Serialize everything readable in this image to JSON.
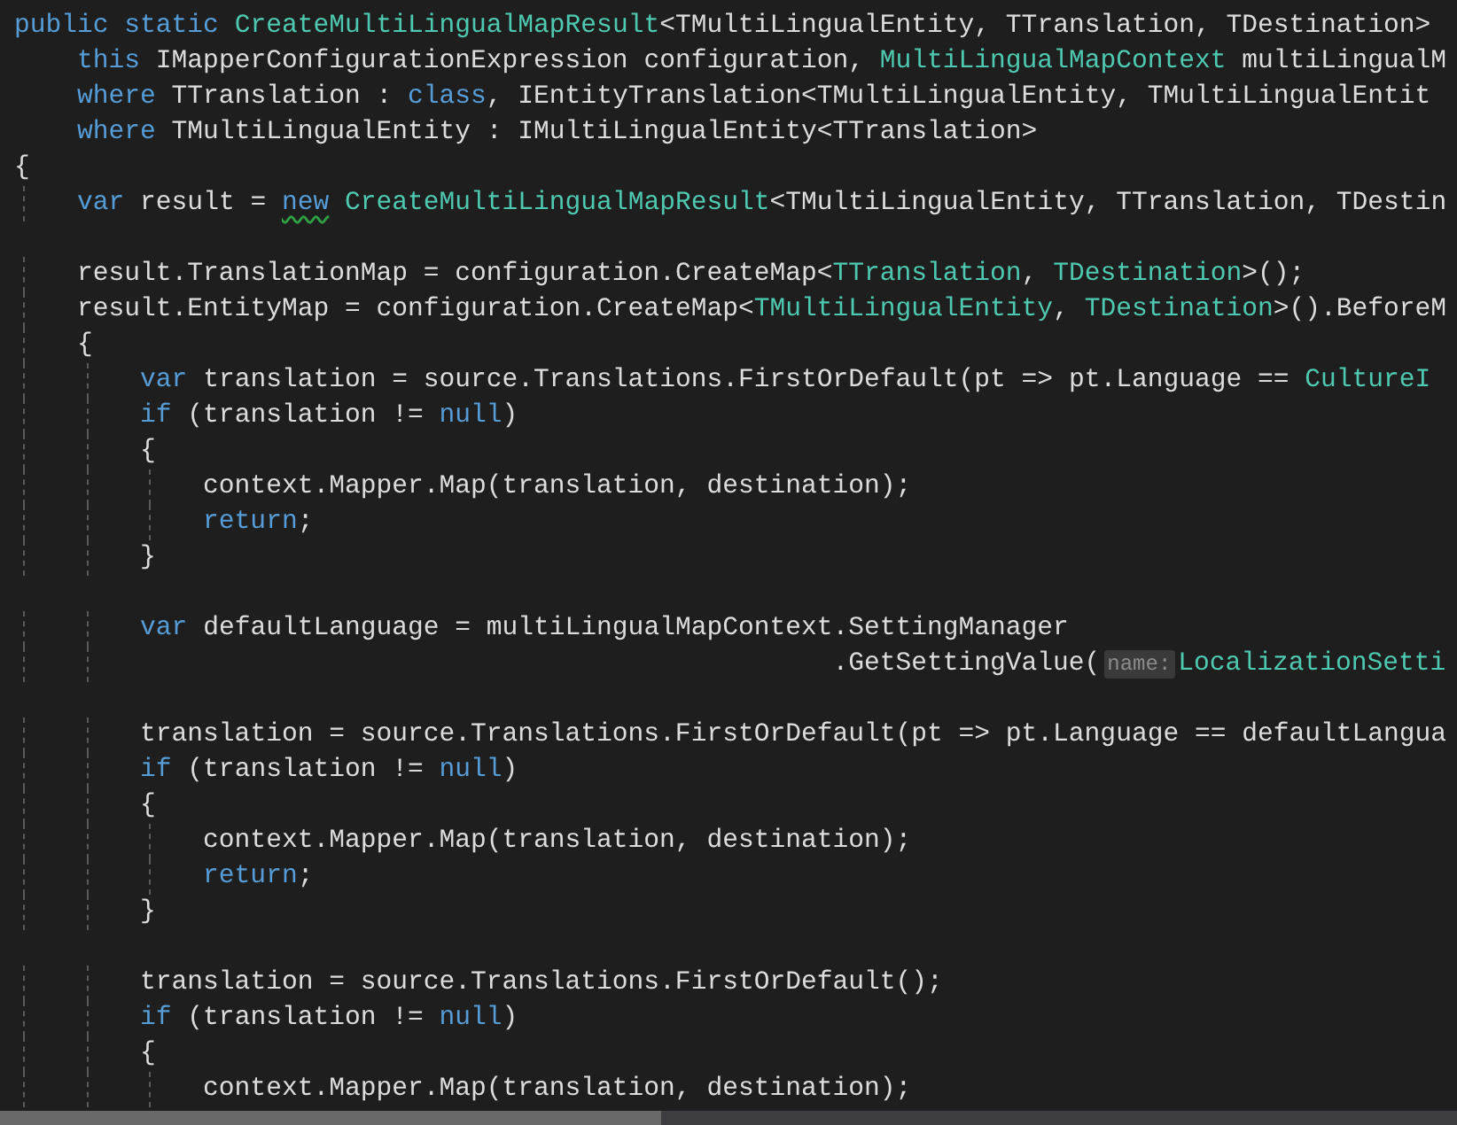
{
  "editor": {
    "lines": [
      {
        "kind": "code",
        "tokens": [
          {
            "kind": "keyword",
            "text": "public static "
          },
          {
            "kind": "type",
            "text": "CreateMultiLingualMapResult"
          },
          {
            "kind": "plain",
            "text": "<TMultiLingualEntity, TTranslation, TDestination>"
          }
        ]
      },
      {
        "kind": "code",
        "tokens": [
          {
            "kind": "keyword",
            "text": "    this "
          },
          {
            "kind": "plain",
            "text": "IMapperConfigurationExpression configuration, "
          },
          {
            "kind": "type",
            "text": "MultiLingualMapContext"
          },
          {
            "kind": "plain",
            "text": " multiLingualM"
          }
        ]
      },
      {
        "kind": "code",
        "tokens": [
          {
            "kind": "keyword",
            "text": "    where "
          },
          {
            "kind": "plain",
            "text": "TTranslation : "
          },
          {
            "kind": "keyword",
            "text": "class"
          },
          {
            "kind": "plain",
            "text": ", IEntityTranslation<TMultiLingualEntity, TMultiLingualEntit"
          }
        ]
      },
      {
        "kind": "code",
        "tokens": [
          {
            "kind": "keyword",
            "text": "    where "
          },
          {
            "kind": "plain",
            "text": "TMultiLingualEntity : IMultiLingualEntity<TTranslation>"
          }
        ]
      },
      {
        "kind": "code",
        "tokens": [
          {
            "kind": "plain",
            "text": "{"
          }
        ]
      },
      {
        "kind": "code",
        "tokens": [
          {
            "kind": "keyword",
            "text": "    var "
          },
          {
            "kind": "plain",
            "text": "result = "
          },
          {
            "kind": "flagged-keyword",
            "text": "new"
          },
          {
            "kind": "type",
            "text": " CreateMultiLingualMapResult"
          },
          {
            "kind": "plain",
            "text": "<TMultiLingualEntity, TTranslation, TDestin"
          }
        ]
      },
      {
        "kind": "blank"
      },
      {
        "kind": "code",
        "tokens": [
          {
            "kind": "plain",
            "text": "    result.TranslationMap = configuration.CreateMap<"
          },
          {
            "kind": "type",
            "text": "TTranslation"
          },
          {
            "kind": "plain",
            "text": ", "
          },
          {
            "kind": "type",
            "text": "TDestination"
          },
          {
            "kind": "plain",
            "text": ">();"
          }
        ]
      },
      {
        "kind": "code",
        "tokens": [
          {
            "kind": "plain",
            "text": "    result.EntityMap = configuration.CreateMap<"
          },
          {
            "kind": "type",
            "text": "TMultiLingualEntity"
          },
          {
            "kind": "plain",
            "text": ", "
          },
          {
            "kind": "type",
            "text": "TDestination"
          },
          {
            "kind": "plain",
            "text": ">().BeforeM"
          }
        ]
      },
      {
        "kind": "code",
        "tokens": [
          {
            "kind": "plain",
            "text": "    {"
          }
        ]
      },
      {
        "kind": "code",
        "tokens": [
          {
            "kind": "keyword",
            "text": "        var "
          },
          {
            "kind": "plain",
            "text": "translation = source.Translations.FirstOrDefault(pt => pt.Language == "
          },
          {
            "kind": "type",
            "text": "CultureI"
          }
        ]
      },
      {
        "kind": "code",
        "tokens": [
          {
            "kind": "keyword",
            "text": "        if"
          },
          {
            "kind": "plain",
            "text": " (translation != "
          },
          {
            "kind": "keyword",
            "text": "null"
          },
          {
            "kind": "plain",
            "text": ")"
          }
        ]
      },
      {
        "kind": "code",
        "tokens": [
          {
            "kind": "plain",
            "text": "        {"
          }
        ]
      },
      {
        "kind": "code",
        "tokens": [
          {
            "kind": "plain",
            "text": "            context.Mapper.Map(translation, destination);"
          }
        ]
      },
      {
        "kind": "code",
        "tokens": [
          {
            "kind": "keyword",
            "text": "            return"
          },
          {
            "kind": "plain",
            "text": ";"
          }
        ]
      },
      {
        "kind": "code",
        "tokens": [
          {
            "kind": "plain",
            "text": "        }"
          }
        ]
      },
      {
        "kind": "blank"
      },
      {
        "kind": "code",
        "tokens": [
          {
            "kind": "keyword",
            "text": "        var "
          },
          {
            "kind": "plain",
            "text": "defaultLanguage = multiLingualMapContext.SettingManager"
          }
        ]
      },
      {
        "kind": "code",
        "tokens": [
          {
            "kind": "plain",
            "text": "                                                    .GetSettingValue("
          },
          {
            "kind": "hint",
            "text": "name:"
          },
          {
            "kind": "type",
            "text": "LocalizationSetti"
          }
        ]
      },
      {
        "kind": "blank"
      },
      {
        "kind": "code",
        "tokens": [
          {
            "kind": "plain",
            "text": "        translation = source.Translations.FirstOrDefault(pt => pt.Language == defaultLangua"
          }
        ]
      },
      {
        "kind": "code",
        "tokens": [
          {
            "kind": "keyword",
            "text": "        if"
          },
          {
            "kind": "plain",
            "text": " (translation != "
          },
          {
            "kind": "keyword",
            "text": "null"
          },
          {
            "kind": "plain",
            "text": ")"
          }
        ]
      },
      {
        "kind": "code",
        "tokens": [
          {
            "kind": "plain",
            "text": "        {"
          }
        ]
      },
      {
        "kind": "code",
        "tokens": [
          {
            "kind": "plain",
            "text": "            context.Mapper.Map(translation, destination);"
          }
        ]
      },
      {
        "kind": "code",
        "tokens": [
          {
            "kind": "keyword",
            "text": "            return"
          },
          {
            "kind": "plain",
            "text": ";"
          }
        ]
      },
      {
        "kind": "code",
        "tokens": [
          {
            "kind": "plain",
            "text": "        }"
          }
        ]
      },
      {
        "kind": "blank"
      },
      {
        "kind": "code",
        "tokens": [
          {
            "kind": "plain",
            "text": "        translation = source.Translations.FirstOrDefault();"
          }
        ]
      },
      {
        "kind": "code",
        "tokens": [
          {
            "kind": "keyword",
            "text": "        if"
          },
          {
            "kind": "plain",
            "text": " (translation != "
          },
          {
            "kind": "keyword",
            "text": "null"
          },
          {
            "kind": "plain",
            "text": ")"
          }
        ]
      },
      {
        "kind": "code",
        "tokens": [
          {
            "kind": "plain",
            "text": "        {"
          }
        ]
      },
      {
        "kind": "code",
        "tokens": [
          {
            "kind": "plain",
            "text": "            context.Mapper.Map(translation, destination);"
          }
        ]
      }
    ]
  }
}
